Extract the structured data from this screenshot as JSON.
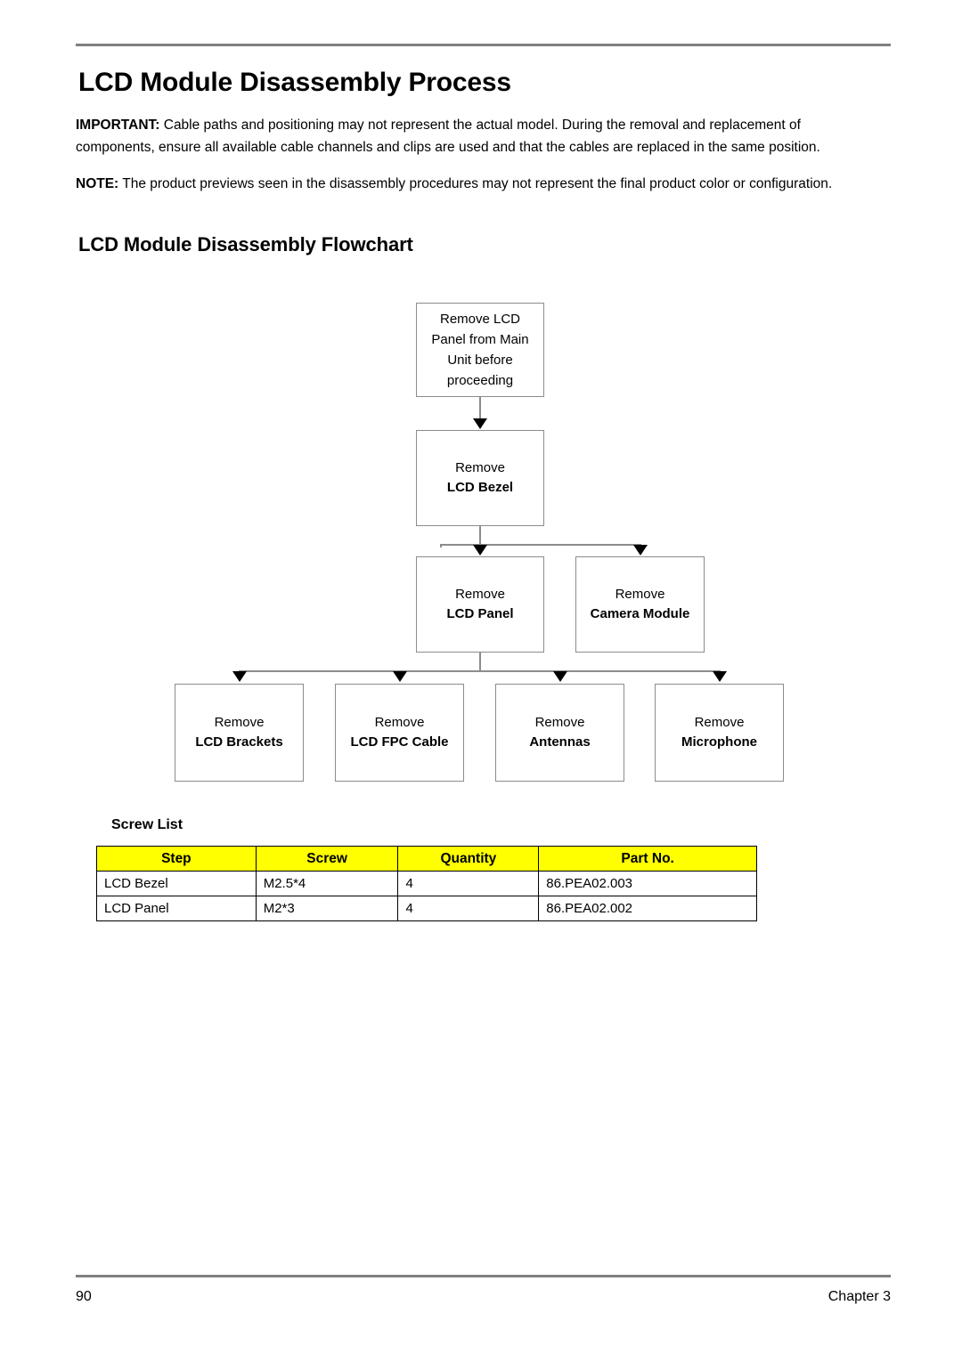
{
  "document": {
    "page_title": "LCD Module Disassembly Process",
    "section_title": "LCD Module Disassembly Flowchart",
    "notices": {
      "important_label": "IMPORTANT:",
      "important_text": " Cable paths and positioning may not represent the actual model. During the removal and replacement of components, ensure all available cable channels and clips are used and that the cables are replaced in the same position.",
      "note_label": "NOTE:",
      "note_text": " The product previews seen in the disassembly procedures may not represent the final product color or configuration."
    }
  },
  "flowchart": {
    "start": {
      "line1": "Remove LCD",
      "line2": "Panel from Main",
      "line3": "Unit before",
      "line4": "proceeding"
    },
    "bezel": {
      "action": "Remove",
      "target": "LCD Bezel"
    },
    "panel": {
      "action": "Remove",
      "target": "LCD Panel"
    },
    "camera": {
      "action": "Remove",
      "target": "Camera Module"
    },
    "brackets": {
      "action": "Remove",
      "target": "LCD Brackets"
    },
    "fpc": {
      "action": "Remove",
      "target": "LCD FPC Cable"
    },
    "antennas": {
      "action": "Remove",
      "target": "Antennas"
    },
    "microphone": {
      "action": "Remove",
      "target": "Microphone"
    }
  },
  "screw_list": {
    "heading": "Screw List",
    "header_bg": "#FFFF00",
    "columns": [
      "Step",
      "Screw",
      "Quantity",
      "Part No."
    ],
    "rows": [
      {
        "step": "LCD Bezel",
        "screw": "M2.5*4",
        "quantity": "4",
        "part_no": "86.PEA02.003"
      },
      {
        "step": "LCD Panel",
        "screw": "M2*3",
        "quantity": "4",
        "part_no": "86.PEA02.002"
      }
    ]
  },
  "footer": {
    "page_number": "90",
    "chapter": "Chapter 3"
  }
}
